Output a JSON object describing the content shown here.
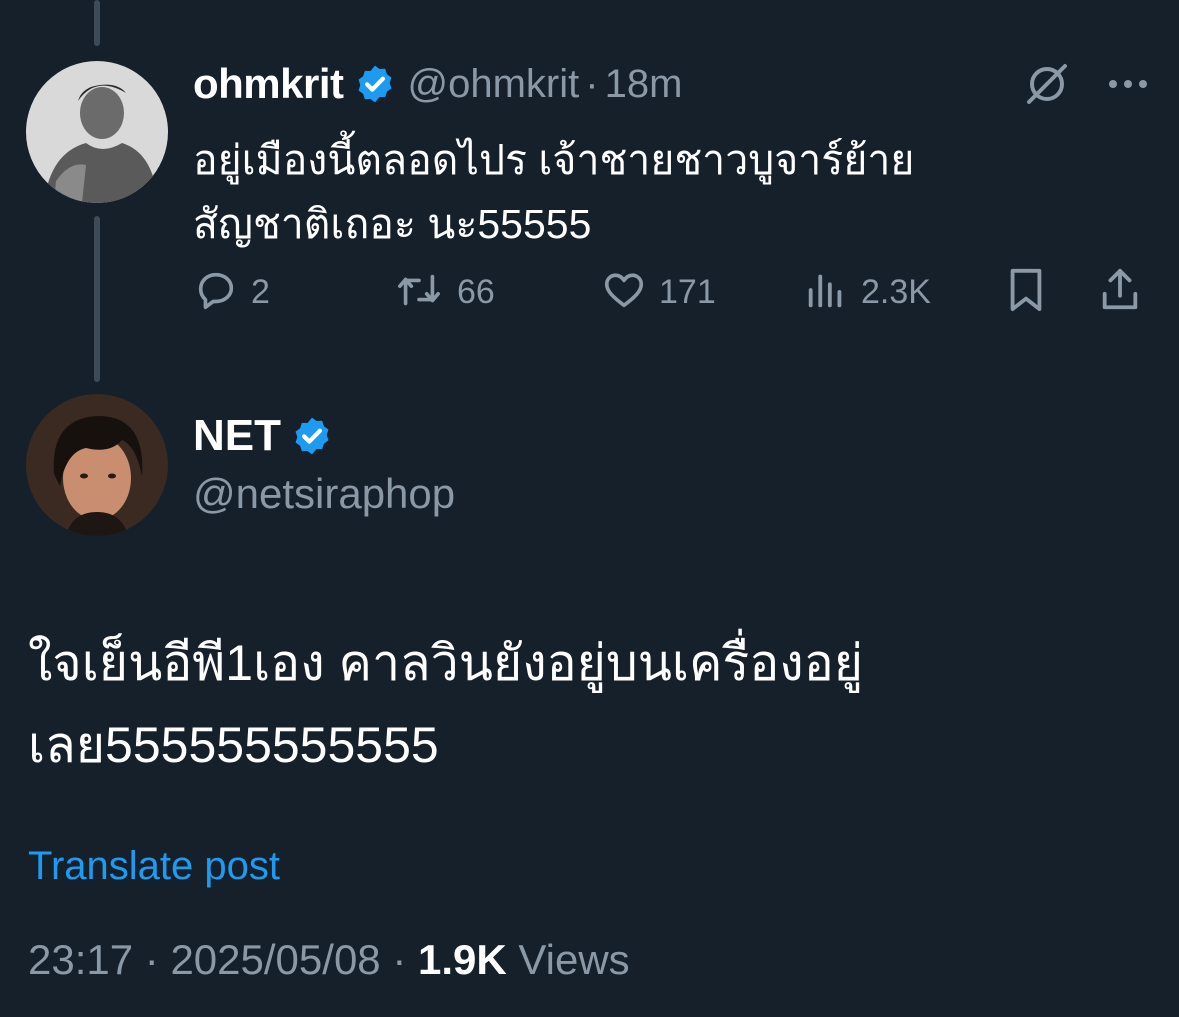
{
  "colors": {
    "background": "#15202b",
    "text": "#ffffff",
    "muted": "#8b98a5",
    "accent": "#1d9bf0",
    "thread_line": "#3d4a57"
  },
  "parent_post": {
    "display_name": "ohmkrit",
    "handle": "@ohmkrit",
    "separator": "·",
    "time": "18m",
    "verified_icon": "verified-badge-icon",
    "text_line1": "อยู่เมืองนี้ตลอดไปร เจ้าชายชาวบูจาร์ย้าย",
    "text_line2": "สัญชาติเถอะ นะ55555",
    "menu_icons": [
      "grok-icon",
      "more-icon"
    ],
    "actions": {
      "replies": "2",
      "reposts": "66",
      "likes": "171",
      "views": "2.3K"
    }
  },
  "main_post": {
    "display_name": "NET",
    "handle": "@netsiraphop",
    "verified_icon": "verified-badge-icon",
    "text_line1": "ใจเย็นอีพี1เอง คาลวินยังอยู่บนเครื่องอยู่",
    "text_line2": "เลย555555555555",
    "translate_label": "Translate post",
    "meta": {
      "time": "23:17",
      "sep1": "·",
      "date": "2025/05/08",
      "sep2": "·",
      "views_count": "1.9K",
      "views_label": "Views"
    }
  }
}
